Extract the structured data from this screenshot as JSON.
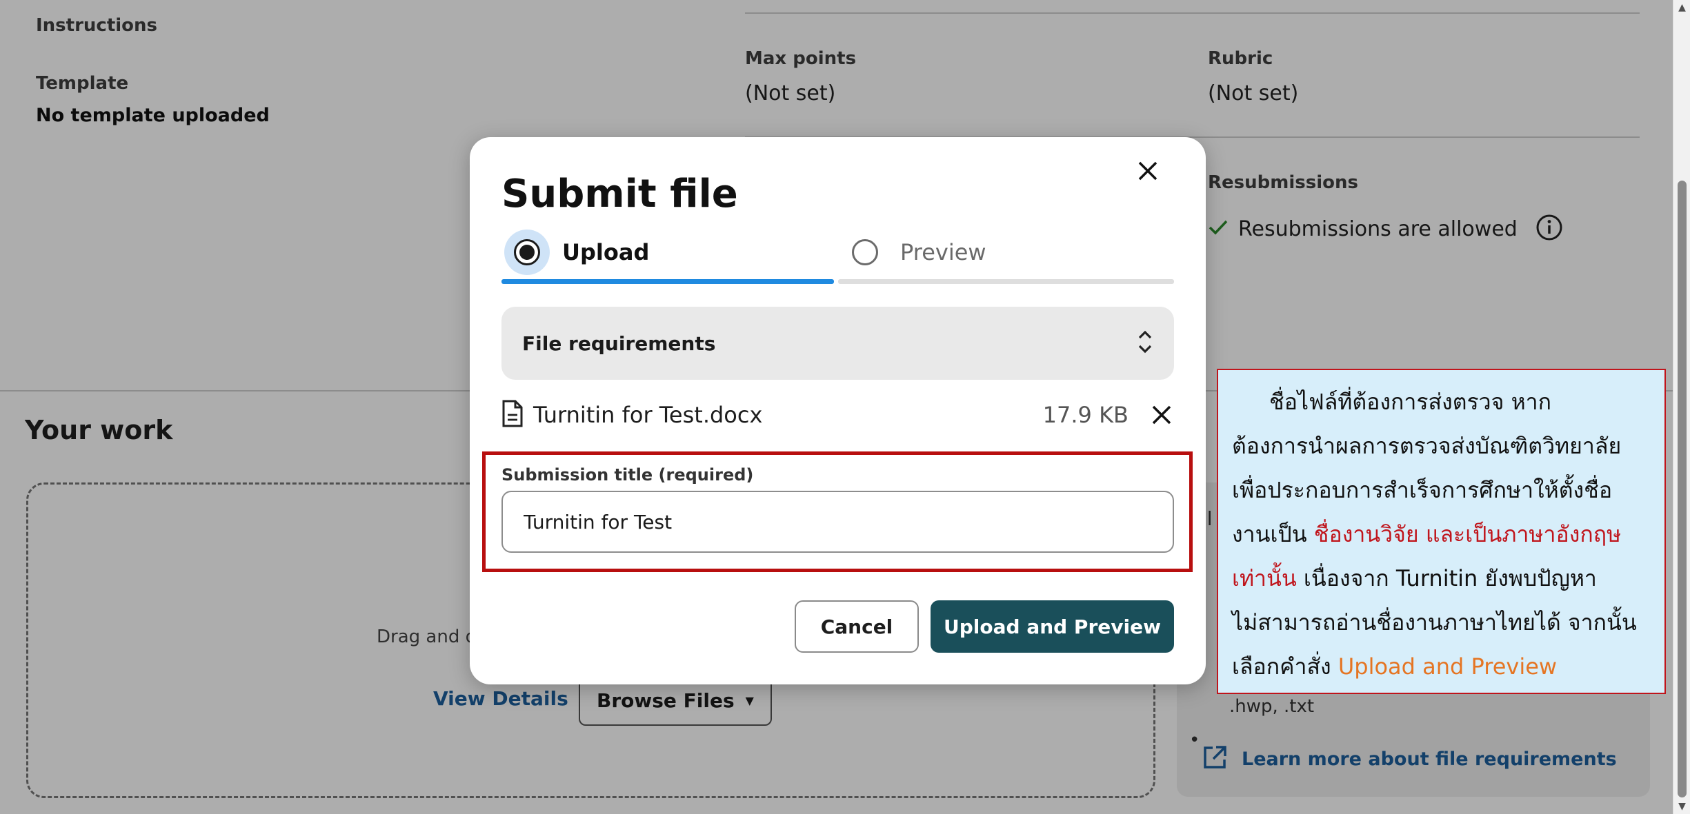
{
  "background": {
    "instructions_label": "Instructions",
    "template_label": "Template",
    "template_value": "No template uploaded",
    "max_points_label": "Max points",
    "max_points_value": "(Not set)",
    "rubric_label": "Rubric",
    "rubric_value": "(Not set)",
    "resubmissions_label": "Resubmissions",
    "resubmissions_value": "Resubmissions are allowed",
    "your_work_title": "Your work",
    "drag_text": "Drag and d",
    "view_details": "View Details",
    "browse_files": "Browse Files",
    "req_partial_1": "il",
    "req_file_types_tail": ".hwp, .txt",
    "learn_more": "Learn more about file requirements"
  },
  "modal": {
    "title": "Submit file",
    "steps": [
      {
        "label": "Upload",
        "active": true
      },
      {
        "label": "Preview",
        "active": false
      }
    ],
    "file_requirements_label": "File requirements",
    "file": {
      "name": "Turnitin for Test.docx",
      "size": "17.9 KB"
    },
    "submission_title_label": "Submission title (required)",
    "submission_title_value": "Turnitin for Test",
    "cancel_label": "Cancel",
    "primary_label": "Upload and Preview"
  },
  "callout": {
    "line1": "ชื่อไฟล์ที่ต้องการส่งตรวจ หาก",
    "line2": "ต้องการนำผลการตรวจส่งบัณฑิตวิทยาลัย",
    "line3": "เพื่อประกอบการสำเร็จการศึกษาให้ตั้งชื่อ",
    "line4_prefix": "งานเป็น ",
    "line4_red": "ชื่องานวิจัย และเป็นภาษาอังกฤษ",
    "line5_red": "เท่านั้น",
    "line5_rest": " เนื่องจาก Turnitin ยังพบปัญหา",
    "line6": "ไม่สามารถอ่านชื่องานภาษาไทยได้ จากนั้น",
    "line7_prefix": "เลือกคำสั่ง ",
    "line7_orange": "Upload and Preview"
  },
  "colors": {
    "primary_button": "#1a4f5a",
    "progress_active": "#1f8ae0",
    "highlight_border": "#b80f0f",
    "callout_bg": "#d7eefa",
    "callout_red": "#c0151c",
    "callout_orange": "#e57523",
    "link": "#1d5f9c"
  }
}
